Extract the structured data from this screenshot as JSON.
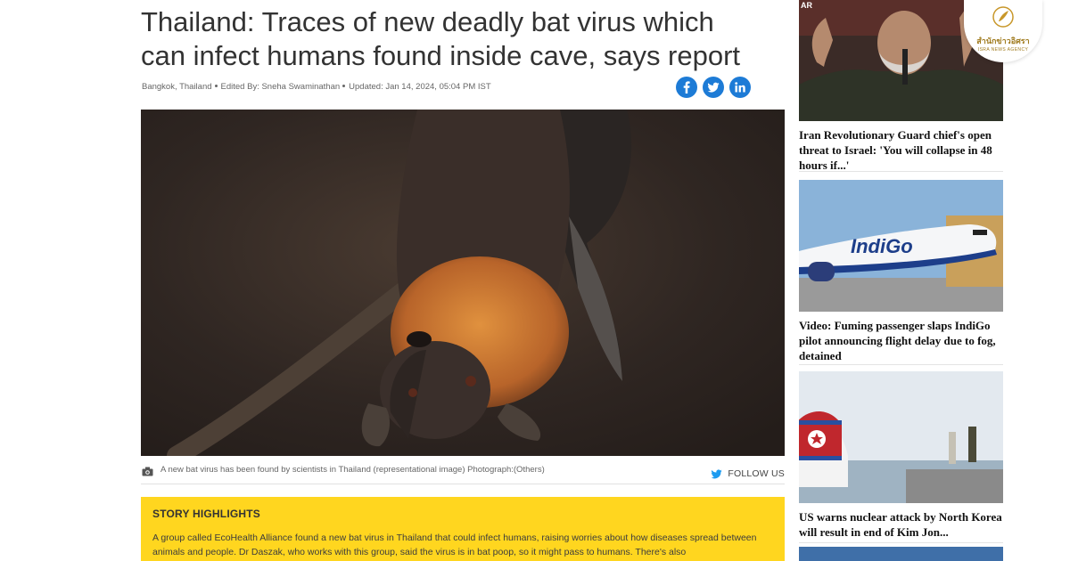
{
  "article": {
    "headline": "Thailand: Traces of new deadly bat virus which can infect humans found inside cave, says report",
    "location": "Bangkok, Thailand",
    "edited_by": "Edited By: Sneha Swaminathan",
    "updated": "Updated: Jan 14, 2024, 05:04 PM IST",
    "image_caption": "A new bat virus has been found by scientists in Thailand (representational image) Photograph:(Others)",
    "follow_label": "FOLLOW US",
    "highlights_title": "STORY HIGHLIGHTS",
    "highlights_text": "A group called EcoHealth Alliance found a new bat virus in Thailand that could infect humans, raising worries about how diseases spread between animals and people. Dr Daszak, who works with this group, said the virus is in bat poop, so it might pass to humans. There's also",
    "share_icons": [
      "facebook-icon",
      "twitter-icon",
      "linkedin-icon"
    ],
    "accent_color": "#1d7bd6",
    "highlight_bg": "#ffd61f"
  },
  "sidebar": {
    "stories": [
      {
        "title": "Iran Revolutionary Guard chief's open threat to Israel: 'You will collapse in 48 hours if...'"
      },
      {
        "title": "Video: Fuming passenger slaps IndiGo pilot announcing flight delay due to fog, detained"
      },
      {
        "title": "US warns nuclear attack by North Korea will result in end of Kim Jon..."
      }
    ]
  },
  "overlay_logo": {
    "thai_name": "สำนักข่าวอิศรา",
    "english_name": "ISRA NEWS AGENCY"
  }
}
